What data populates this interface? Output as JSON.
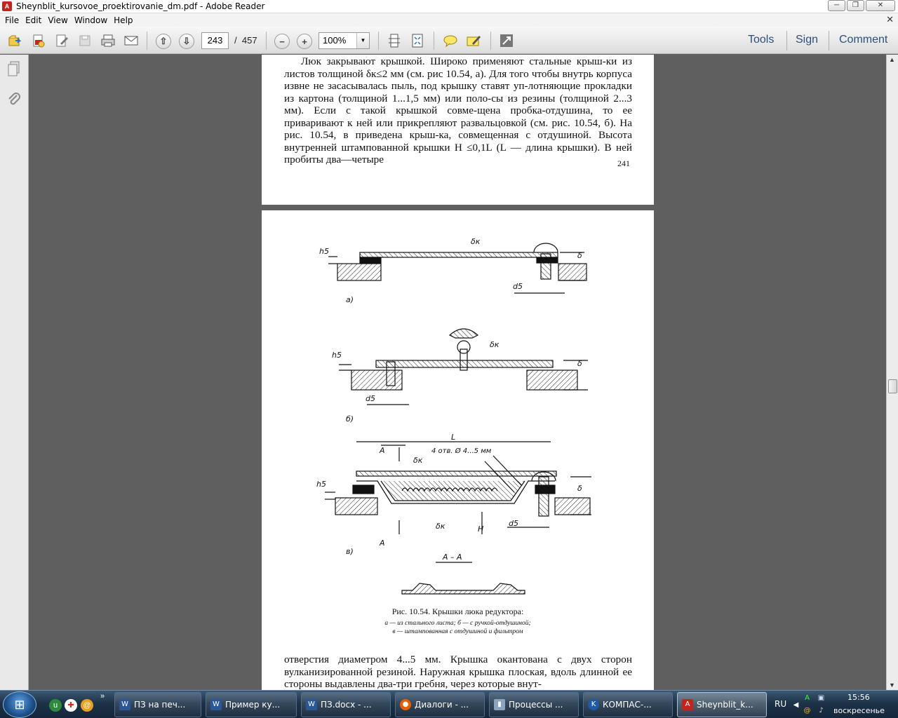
{
  "window": {
    "title": "Sheynblit_kursovoe_proektirovanie_dm.pdf - Adobe Reader",
    "controls": [
      "─",
      "❐",
      "✕"
    ]
  },
  "menu": [
    "File",
    "Edit",
    "View",
    "Window",
    "Help"
  ],
  "toolbar": {
    "page_current": "243",
    "page_sep": "/",
    "page_total": "457",
    "zoom": "100%",
    "links": [
      "Tools",
      "Sign",
      "Comment"
    ]
  },
  "document": {
    "page1_text": "Люк закрывают крышкой. Широко применяют стальные крыш-ки из листов толщиной δк≤2 мм (см. рис 10.54, а). Для того чтобы внутрь корпуса извне не засасывалась пыль, под крышку ставят уп-лотняющие прокладки из картона (толщиной 1...1,5 мм) или поло-сы из резины (толщиной 2...3 мм). Если с такой крышкой совме-щена пробка-отдушина, то ее приваривают к ней или прикрепляют развальцовкой (см. рис. 10.54, б). На рис. 10.54, в приведена крыш-ка, совмещенная с отдушиной. Высота внутренней штампованной крышки H ≤0,1L (L — длина крышки). В ней пробиты два—четыре",
    "page1_number": "241",
    "fig_labels": {
      "h5": "h5",
      "dk": "δк",
      "delta": "δ",
      "d5": "d5",
      "a": "а)",
      "b": "б)",
      "v": "в)",
      "L": "L",
      "A": "A",
      "holes": "4 отв. Ø 4...5 мм",
      "H": "H",
      "section": "А – А"
    },
    "caption_title": "Рис. 10.54. Крышки люка редуктора:",
    "caption_line2": "а — из стального листа; б — с ручкой-отдушиной;",
    "caption_line3": "в — штампованная с отдушиной и фильтром",
    "page2_text": "отверстия диаметром 4...5 мм. Крышка окантована с двух сторон вулканизированной резиной. Наружная крышка плоская, вдоль длинной ее стороны выдавлены два-три гребня, через которые внут-"
  },
  "taskbar": {
    "tasks": [
      {
        "label": "ПЗ на печ...",
        "icon": "word-icon"
      },
      {
        "label": "Пример ку...",
        "icon": "word-icon"
      },
      {
        "label": "ПЗ.docx - ...",
        "icon": "word-icon"
      },
      {
        "label": "Диалоги - ...",
        "icon": "firefox-icon"
      },
      {
        "label": "Процессы ...",
        "icon": "process-icon"
      },
      {
        "label": "КОМПАС-...",
        "icon": "kompas-icon"
      },
      {
        "label": "Sheynblit_k...",
        "icon": "pdf-icon"
      }
    ],
    "lang": "RU",
    "time": "15:56",
    "day": "воскресенье"
  }
}
